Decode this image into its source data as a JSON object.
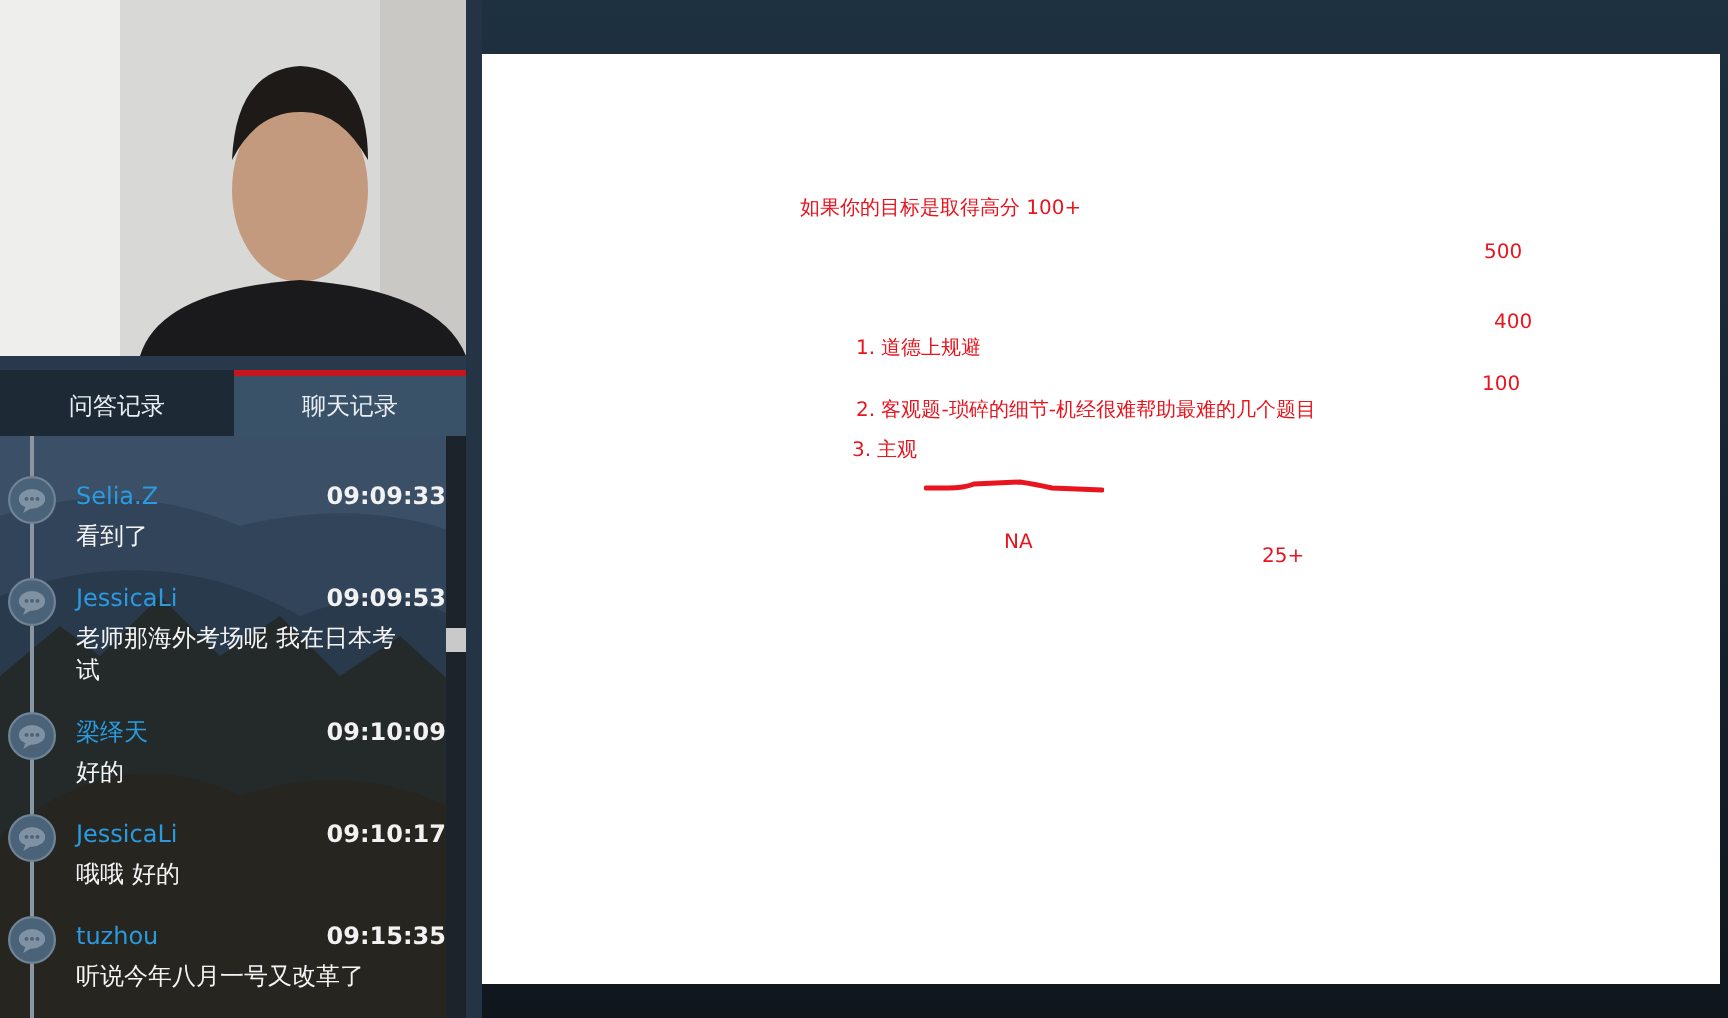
{
  "tabs": [
    {
      "label": "问答记录",
      "selected": false
    },
    {
      "label": "聊天记录",
      "selected": true
    }
  ],
  "messages": [
    {
      "name": "Selia.Z",
      "time": "09:09:33",
      "text": "看到了"
    },
    {
      "name": "JessicaLi",
      "time": "09:09:53",
      "text": "老师那海外考场呢 我在日本考试"
    },
    {
      "name": "梁绎天",
      "time": "09:10:09",
      "text": "好的"
    },
    {
      "name": "JessicaLi",
      "time": "09:10:17",
      "text": "哦哦 好的"
    },
    {
      "name": "tuzhou",
      "time": "09:15:35",
      "text": "听说今年八月一号又改革了"
    }
  ],
  "board": {
    "notes": [
      {
        "text": "如果你的目标是取得高分 100+"
      },
      {
        "text": "500"
      },
      {
        "text": "400"
      },
      {
        "text": "1. 道德上规避"
      },
      {
        "text": "100"
      },
      {
        "text": "2. 客观题-琐碎的细节-机经很难帮助最难的几个题目"
      },
      {
        "text": "3. 主观"
      },
      {
        "text": "NA"
      },
      {
        "text": "25+"
      }
    ]
  }
}
